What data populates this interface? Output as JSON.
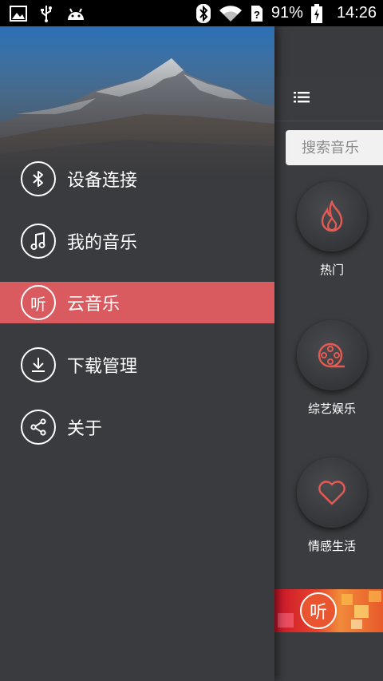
{
  "status_bar": {
    "battery": "91%",
    "time": "14:26",
    "icons": [
      "image-icon",
      "usb-icon",
      "android-icon",
      "bluetooth-icon",
      "wifi-icon",
      "no-sim-icon",
      "battery-charging-icon"
    ]
  },
  "drawer": {
    "items": [
      {
        "label": "设备连接",
        "icon": "bluetooth-icon",
        "active": false
      },
      {
        "label": "我的音乐",
        "icon": "music-note-icon",
        "active": false
      },
      {
        "label": "云音乐",
        "icon": "ting-icon",
        "icon_text": "听",
        "active": true
      },
      {
        "label": "下载管理",
        "icon": "download-icon",
        "active": false
      },
      {
        "label": "关于",
        "icon": "share-icon",
        "active": false
      }
    ]
  },
  "main": {
    "menu_icon": "hamburger-menu-icon",
    "search": {
      "placeholder": "搜索音乐"
    },
    "categories": [
      {
        "label": "热门",
        "icon": "flame-icon"
      },
      {
        "label": "综艺娱乐",
        "icon": "film-reel-icon"
      },
      {
        "label": "情感生活",
        "icon": "heart-icon"
      }
    ],
    "banner": {
      "logo_text": "听"
    }
  },
  "colors": {
    "accent": "#d95b5f",
    "background": "#3a3b3e",
    "icon_red": "#e55a52"
  }
}
